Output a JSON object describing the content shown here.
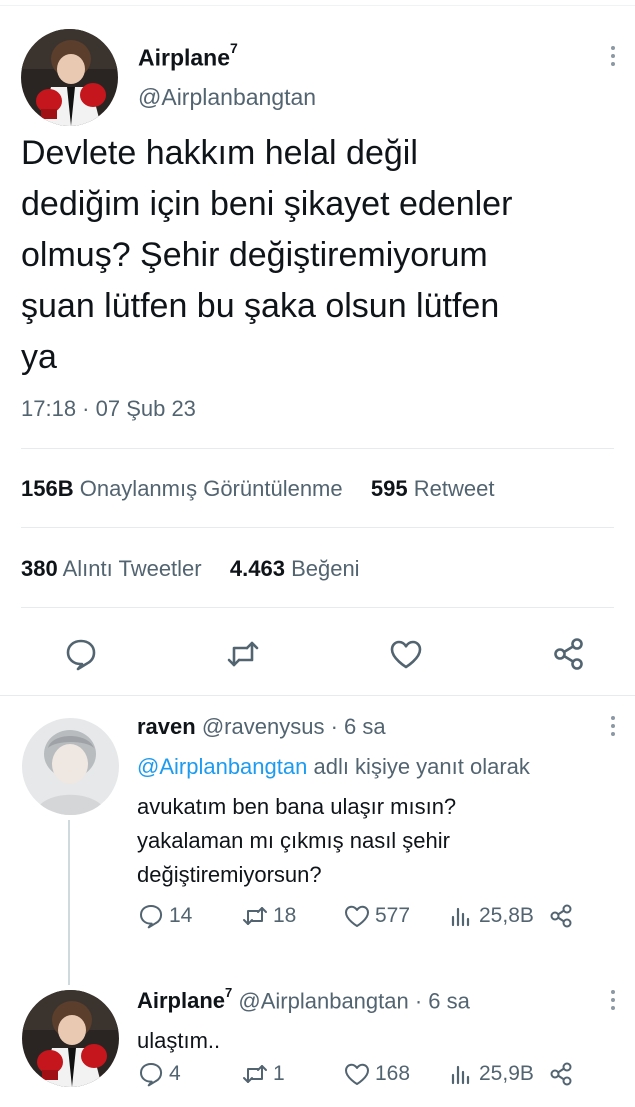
{
  "main_tweet": {
    "display_name": "Airplane",
    "name_superscript": "7",
    "handle": "@Airplanbangtan",
    "text": "Devlete hakkım helal değil\ndediğim için beni şikayet edenler\nolmuş? Şehir değiştiremiyorum\nşuan lütfen bu şaka olsun lütfen\nya",
    "timestamp": "17:18 · 07 Şub 23",
    "views_count": "156B",
    "views_label": "Onaylanmış Görüntülenme",
    "retweets_count": "595",
    "retweets_label": "Retweet",
    "quotes_count": "380",
    "quotes_label": "Alıntı Tweetler",
    "likes_count": "4.463",
    "likes_label": "Beğeni",
    "icons": [
      "reply-icon",
      "retweet-icon",
      "like-icon",
      "share-icon"
    ]
  },
  "reply1": {
    "display_name": "raven",
    "handle": "@ravenysus",
    "time": "· 6 sa",
    "replying_mention": "@Airplanbangtan",
    "replying_suffix": "adlı kişiye yanıt olarak",
    "text_line1": "avukatım ben bana ulaşır mısın?",
    "text_line2": "yakalaman mı çıkmış nasıl şehir",
    "text_line3": "değiştiremiyorsun?",
    "replies": "14",
    "retweets": "18",
    "likes": "577",
    "views": "25,8B"
  },
  "reply2": {
    "display_name": "Airplane",
    "name_superscript": "7",
    "handle": "@Airplanbangtan",
    "time": "· 6 sa",
    "text": "ulaştım..",
    "replies": "4",
    "retweets": "1",
    "likes": "168",
    "views": "25,9B"
  },
  "colors": {
    "text": "#0f1419",
    "secondary": "#536471",
    "link": "#1d9bf0",
    "divider": "#e7ebed"
  }
}
